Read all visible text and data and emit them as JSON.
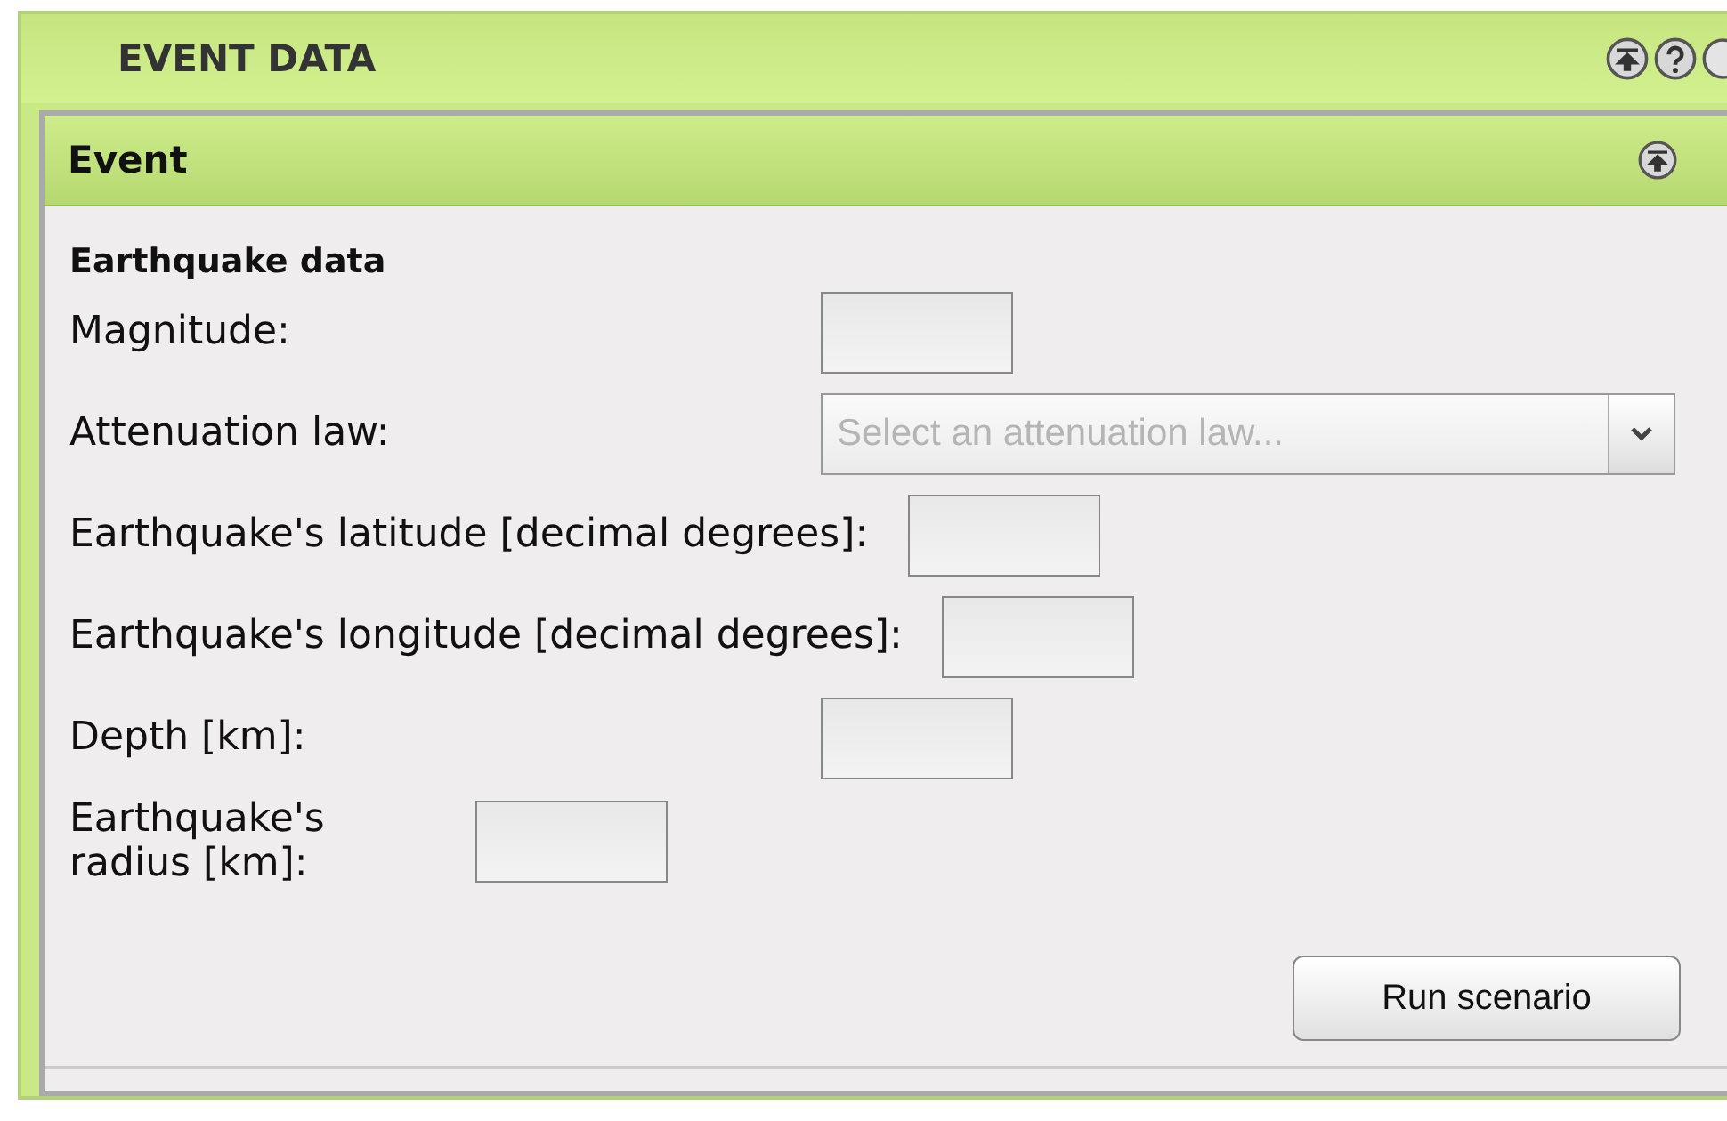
{
  "window": {
    "title": "EVENT DATA"
  },
  "panel": {
    "title": "Event",
    "section_title": "Earthquake data",
    "fields": [
      {
        "kind": "input",
        "label": "Magnitude:"
      },
      {
        "kind": "select",
        "label": "Attenuation law:",
        "placeholder": "Select an attenuation law..."
      },
      {
        "kind": "input",
        "label": "Earthquake's latitude [decimal degrees]:"
      },
      {
        "kind": "input",
        "label": "Earthquake's longitude [decimal degrees]:"
      },
      {
        "kind": "input",
        "label": "Depth [km]:"
      },
      {
        "kind": "narrow",
        "label": "Earthquake's radius [km]:"
      }
    ],
    "button": "Run scenario"
  }
}
